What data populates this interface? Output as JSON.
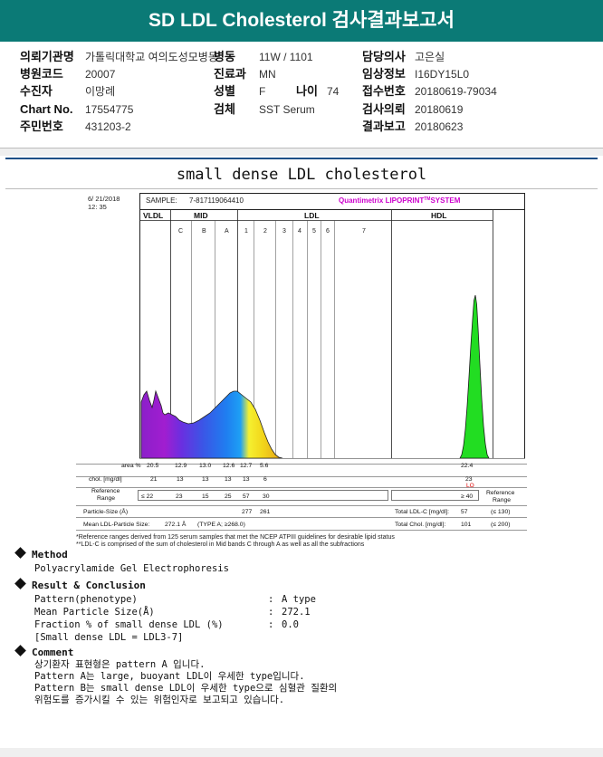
{
  "report": {
    "title": "SD LDL Cholesterol 검사결과보고서"
  },
  "patient": {
    "fields": [
      {
        "label": "의뢰기관명",
        "value": "가톨릭대학교 여의도성모병동"
      },
      {
        "label": "병원코드",
        "value": "20007"
      },
      {
        "label": "수진자",
        "value": "이망례"
      },
      {
        "label": "Chart No.",
        "value": "17554775"
      },
      {
        "label": "주민번호",
        "value": "431203-2"
      },
      {
        "label": "병동",
        "value": "11W / 1101"
      },
      {
        "label": "진료과",
        "value": "MN"
      },
      {
        "label": "성별",
        "value": "F"
      },
      {
        "label": "나이",
        "value": "74"
      },
      {
        "label": "검체",
        "value": "SST Serum"
      },
      {
        "label": "담당의사",
        "value": "고은실"
      },
      {
        "label": "임상정보",
        "value": "I16DY15L0"
      },
      {
        "label": "접수번호",
        "value": "20180619-79034"
      },
      {
        "label": "검사의뢰",
        "value": "20180619"
      },
      {
        "label": "결과보고",
        "value": "20180623"
      }
    ]
  },
  "section_title": "small dense LDL cholesterol",
  "scan": {
    "date": "6/ 21/2018",
    "time": "12: 35",
    "sample_label": "SAMPLE:",
    "sample_id": "7-817119064410",
    "brand": "Quantimetrix LIPOPRINT",
    "brand_sup": "TM",
    "brand_system": "SYSTEM",
    "bands": {
      "vldl": "VLDL",
      "mid": "MID",
      "ldl": "LDL",
      "hdl": "HDL",
      "mid_sub": [
        "C",
        "B",
        "A"
      ],
      "ldl_sub": [
        "1",
        "2",
        "3",
        "4",
        "5",
        "6",
        "7"
      ]
    },
    "rows": {
      "area_label": "area %",
      "area": [
        "20.5",
        "12.9",
        "13.0",
        "12.6",
        "12.7",
        "5.6"
      ],
      "area_hdl": "22.4",
      "chol_label": "chol. [mg/dl]",
      "chol": [
        "21",
        "13",
        "13",
        "13",
        "13",
        "6"
      ],
      "chol_hdl": "23",
      "chol_hdl_flag": "LO",
      "ref_label_1": "Reference",
      "ref_label_2": "Range",
      "ref": [
        "≤ 22",
        "23",
        "15",
        "25",
        "57",
        "30"
      ],
      "ref_hdl": "≥ 40",
      "ref_right_1": "Reference",
      "ref_right_2": "Range",
      "particle_label": "Particle-Size (Å)",
      "particle_values": [
        "277",
        "261"
      ],
      "mean_label": "Mean LDL-Particle Size:",
      "mean_value": "272.1 Å",
      "mean_type": "(TYPE A; ≥268.0)",
      "total_ldl_label": "Total LDL-C [mg/dl]:",
      "total_ldl_value": "57",
      "total_ldl_ref": "(≤ 130)",
      "total_chol_label": "Total Chol. [mg/dl]:",
      "total_chol_value": "101",
      "total_chol_ref": "(≤ 200)"
    }
  },
  "chart_data": {
    "type": "area",
    "title": "",
    "xlabel": "",
    "ylabel": "",
    "bands": [
      "VLDL",
      "MID C",
      "MID B",
      "MID A",
      "LDL 1",
      "LDL 2",
      "HDL"
    ],
    "area_percent": [
      20.5,
      12.9,
      13.0,
      12.6,
      12.7,
      5.6,
      22.4
    ],
    "cholesterol_mg_dl": [
      21,
      13,
      13,
      13,
      13,
      6,
      23
    ],
    "grid": false
  },
  "footnotes": [
    "*Reference ranges derived from 125 serum samples that met the NCEP ATPIII guidelines for desirable lipid status",
    "**LDL-C is comprised of the sum of cholesterol in Mid bands C through A as well as all the subfractions"
  ],
  "method": {
    "title": "Method",
    "text": "Polyacrylamide Gel Electrophoresis"
  },
  "result": {
    "title": "Result & Conclusion",
    "rows": [
      {
        "label": "Pattern(phenotype)",
        "colon": ":",
        "value": "A type"
      },
      {
        "label": "Mean Particle Size(Å)",
        "colon": ":",
        "value": "272.1"
      },
      {
        "label": "Fraction % of small dense LDL (%)",
        "colon": ":",
        "value": "0.0"
      }
    ],
    "note": "[Small dense LDL = LDL3-7]"
  },
  "comment": {
    "title": "Comment",
    "lines": [
      "상기환자 표현형은 pattern A 입니다.",
      "Pattern A는 large, buoyant LDL이 우세한 type입니다.",
      "Pattern B는 small dense LDL이 우세한 type으로 심혈관 질환의",
      "위험도를 증가시킬 수 있는 위험인자로 보고되고 있습니다."
    ]
  },
  "colors": {
    "header": "#0b7a76",
    "divider": "#1d4f86",
    "vldl": "#8a1fc9",
    "mid": "#3b55e6",
    "ldl_yellow": "#f2ea2a",
    "hdl": "#22dd22",
    "brand": "#cc00cc",
    "lo_flag": "#dd0000"
  }
}
